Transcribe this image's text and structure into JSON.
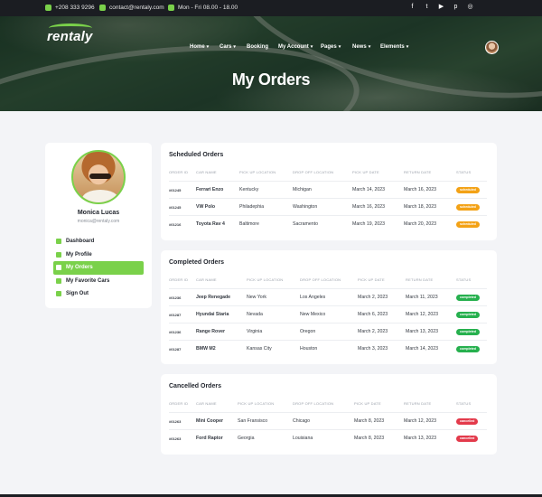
{
  "topbar": {
    "phone": "+208 333 9296",
    "email": "contact@rentaly.com",
    "hours": "Mon - Fri 08.00 - 18.00",
    "social_icons": [
      "facebook-icon",
      "twitter-icon",
      "youtube-icon",
      "pinterest-icon",
      "instagram-icon"
    ]
  },
  "header": {
    "logo": "rentaly",
    "nav": [
      {
        "label": "Home",
        "caret": true
      },
      {
        "label": "Cars",
        "caret": true
      },
      {
        "label": "Booking",
        "caret": false
      },
      {
        "label": "My Account",
        "caret": true
      },
      {
        "label": "Pages",
        "caret": true
      },
      {
        "label": "News",
        "caret": true
      },
      {
        "label": "Elements",
        "caret": true
      }
    ],
    "page_title": "My Orders"
  },
  "profile": {
    "name": "Monica Lucas",
    "email": "monica@rentaly.com",
    "menu": [
      {
        "label": "Dashboard",
        "icon": "home-icon",
        "active": false
      },
      {
        "label": "My Profile",
        "icon": "user-icon",
        "active": false
      },
      {
        "label": "My Orders",
        "icon": "calendar-icon",
        "active": true
      },
      {
        "label": "My Favorite Cars",
        "icon": "car-icon",
        "active": false
      },
      {
        "label": "Sign Out",
        "icon": "sign-out-icon",
        "active": false
      }
    ]
  },
  "headers": [
    "Order ID",
    "Car Name",
    "Pick Up Location",
    "Drop Off Location",
    "Pick Up Date",
    "Return Date",
    "Status"
  ],
  "sections": [
    {
      "title": "Scheduled Orders",
      "rows": [
        [
          "#01245",
          "Ferrari Enzo",
          "Kentucky",
          "Michigan",
          "March 14, 2023",
          "March 16, 2023",
          "scheduled"
        ],
        [
          "#01245",
          "VW Polo",
          "Philadephia",
          "Washington",
          "March 16, 2023",
          "March 18, 2023",
          "scheduled"
        ],
        [
          "#01216",
          "Toyota Rav 4",
          "Baltimore",
          "Sacramento",
          "March 19, 2023",
          "March 20, 2023",
          "scheduled"
        ]
      ]
    },
    {
      "title": "Completed Orders",
      "rows": [
        [
          "#01236",
          "Jeep Renegade",
          "New York",
          "Los Angeles",
          "March 2, 2023",
          "March 11, 2023",
          "completed"
        ],
        [
          "#01287",
          "Hyundai Staria",
          "Nevada",
          "New Mexico",
          "March 6, 2023",
          "March 12, 2023",
          "completed"
        ],
        [
          "#01236",
          "Range Rover",
          "Virginia",
          "Oregon",
          "March 2, 2023",
          "March 13, 2023",
          "completed"
        ],
        [
          "#01287",
          "BMW M2",
          "Kansas City",
          "Houston",
          "March 3, 2023",
          "March 14, 2023",
          "completed"
        ]
      ]
    },
    {
      "title": "Cancelled Orders",
      "rows": [
        [
          "#01263",
          "Mini Cooper",
          "San Fransisco",
          "Chicago",
          "March 8, 2023",
          "March 12, 2023",
          "cancelled"
        ],
        [
          "#01263",
          "Ford Raptor",
          "Georgia",
          "Louisiana",
          "March 8, 2023",
          "March 13, 2023",
          "cancelled"
        ]
      ]
    }
  ],
  "colors": {
    "accent": "#7ad14a",
    "scheduled": "#f3a216",
    "completed": "#26b04e",
    "cancelled": "#e33a4b"
  }
}
